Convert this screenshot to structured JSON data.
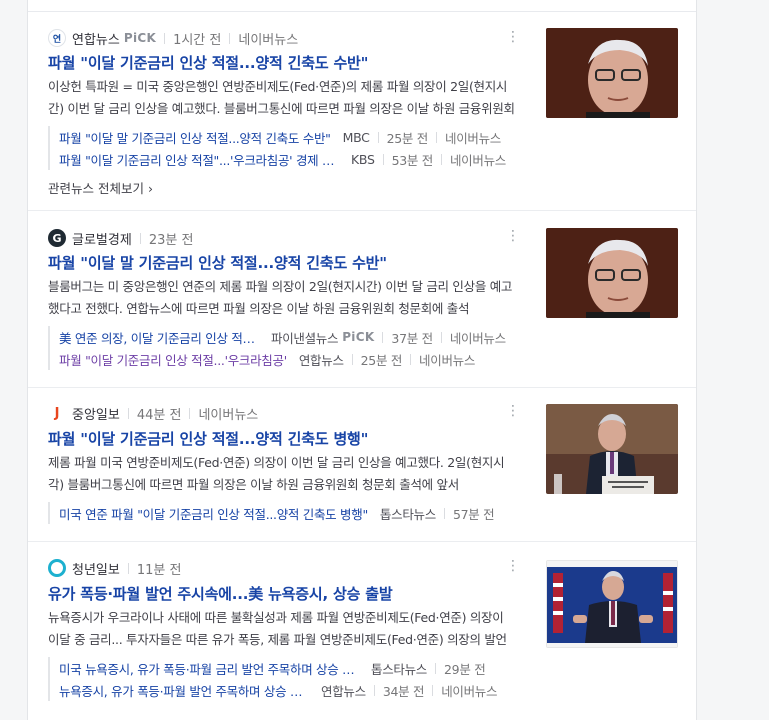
{
  "articles": [
    {
      "source": "연합뉴스",
      "pick": "PiCK",
      "time": "1시간 전",
      "portal": "네이버뉴스",
      "title": "파월 \"이달 기준금리 인상 적절...양적 긴축도 수반\"",
      "snippet": "이상헌 특파원 = 미국 중앙은행인 연방준비제도(Fed·연준)의 제롬 파월 의장이 2일(현지시간) 이번 달 금리 인상을 예고했다. 블룸버그통신에 따르면 파월 의장은 이날 하원 금융위원회 청문회 출석에 앞서 공개한 서면 답변을 통해",
      "related": [
        {
          "title": "파월 \"이달 말 기준금리 인상 적절...양적 긴축도 수반\"",
          "source": "MBC",
          "time": "25분 전",
          "portal": "네이버뉴스"
        },
        {
          "title": "파월 \"이달 기준금리 인상 적절\"...'우크라침공' 경제 영향",
          "source": "KBS",
          "time": "53분 전",
          "portal": "네이버뉴스"
        }
      ],
      "see_all": "관련뉴스 전체보기 ›"
    },
    {
      "source": "글로벌경제",
      "time": "23분 전",
      "title": "파월 \"이달 말 기준금리 인상 적절...양적 긴축도 수반\"",
      "snippet": "블룸버그는 미 중앙은행인 연준의 제롬 파월 의장이 2일(현지시간) 이번 달 금리 인상을 예고했다고 전했다. 연합뉴스에 따르면 파월 의장은 이날 하원 금융위원회 청문회에 출석",
      "related": [
        {
          "title": "美 연준 의장, 이달 기준금리 인상 적절...",
          "source": "파이낸셜뉴스",
          "pick": "PiCK",
          "time": "37분 전",
          "portal": "네이버뉴스"
        },
        {
          "title": "파월 \"이달 기준금리 인상 적절...'우크라침공'",
          "source": "연합뉴스",
          "time": "25분 전",
          "portal": "네이버뉴스"
        }
      ]
    },
    {
      "source": "중앙일보",
      "time": "44분 전",
      "portal": "네이버뉴스",
      "title": "파월 \"이달 기준금리 인상 적절...양적 긴축도 병행\"",
      "snippet": "제롬 파월 미국 연방준비제도(Fed·연준) 의장이 이번 달 금리 인상을 예고했다. 2일(현지시각) 블룸버그통신에 따르면 파월 의장은 이날 하원 금융위원회 청문회 출석에 앞서",
      "related": [
        {
          "title": "미국 연준 파월 \"이달 기준금리 인상 적절...양적 긴축도 병행\"",
          "source": "톱스타뉴스",
          "time": "57분 전"
        }
      ]
    },
    {
      "source": "청년일보",
      "time": "11분 전",
      "title": "유가 폭등·파월 발언 주시속에...美 뉴욕증시, 상승 출발",
      "snippet": "뉴욕증시가 우크라이나 사태에 따른 불확실성과 제롬 파월 연방준비제도(Fed·연준) 의장이 이달 중 금리... 투자자들은 따른 유가 폭등, 제롬 파월 연방준비제도(Fed·연준) 의장의 발언",
      "related": [
        {
          "title": "미국 뉴욕증시, 유가 폭등·파월 금리 발언 주목하며 상승 출발",
          "source": "톱스타뉴스",
          "time": "29분 전"
        },
        {
          "title": "뉴욕증시, 유가 폭등·파월 발언 주목하며 상승 출발",
          "source": "연합뉴스",
          "time": "34분 전",
          "portal": "네이버뉴스"
        }
      ]
    }
  ]
}
